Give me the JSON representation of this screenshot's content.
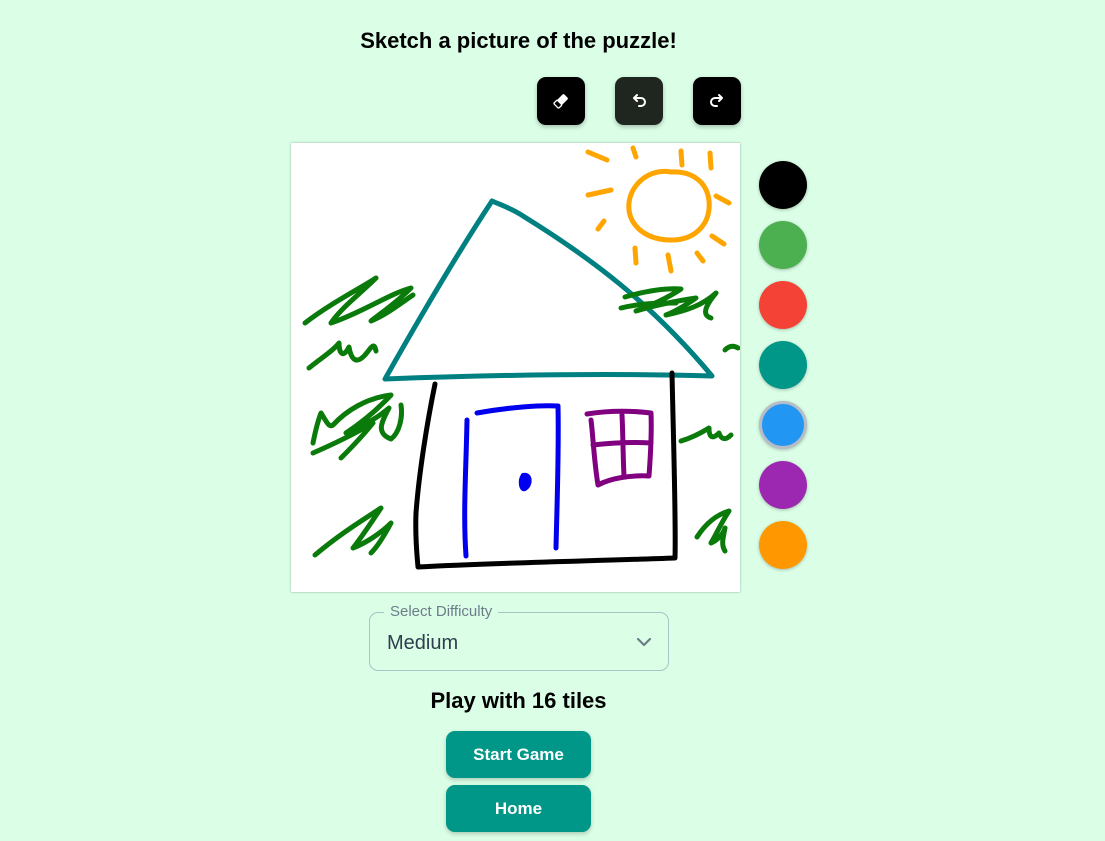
{
  "header": {
    "title": "Sketch a picture of the puzzle!"
  },
  "toolbar": {
    "eraser_icon": "eraser-icon",
    "undo_icon": "undo-icon",
    "redo_icon": "redo-icon"
  },
  "palette": {
    "colors": [
      "#000000",
      "#4caf50",
      "#f44336",
      "#009688",
      "#2196f3",
      "#9c27b0",
      "#ff9800"
    ],
    "selected_color": "#2196f3"
  },
  "difficulty": {
    "label": "Select Difficulty",
    "value": "Medium"
  },
  "tiles_text": "Play with 16 tiles",
  "buttons": {
    "start_label": "Start Game",
    "home_label": "Home"
  },
  "theme": {
    "background": "#dafee6",
    "accent": "#009688"
  }
}
